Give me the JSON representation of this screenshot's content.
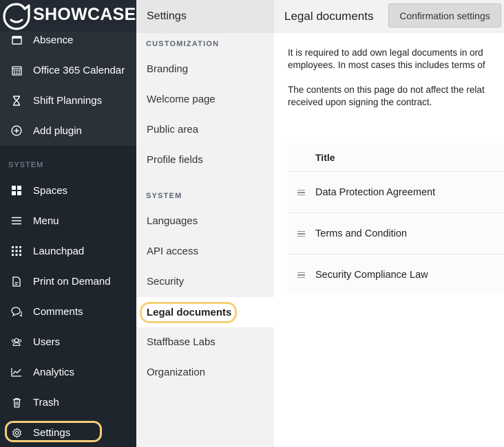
{
  "brand": {
    "name": "SHOWCASE",
    "highlight_color": "#f6cf76"
  },
  "sidebar": {
    "plugin_items": [
      {
        "label": "Absence",
        "icon": "calendar-icon"
      },
      {
        "label": "Office 365 Calendar",
        "icon": "calendar-grid-icon"
      },
      {
        "label": "Shift Plannings",
        "icon": "hourglass-icon"
      },
      {
        "label": "Add plugin",
        "icon": "plus-circle-icon"
      }
    ],
    "system_section": "SYSTEM",
    "system_items": [
      {
        "label": "Spaces",
        "icon": "grid-icon"
      },
      {
        "label": "Menu",
        "icon": "menu-icon"
      },
      {
        "label": "Launchpad",
        "icon": "apps-icon"
      },
      {
        "label": "Print on Demand",
        "icon": "document-icon"
      },
      {
        "label": "Comments",
        "icon": "comments-icon"
      },
      {
        "label": "Users",
        "icon": "users-icon"
      },
      {
        "label": "Analytics",
        "icon": "analytics-icon"
      },
      {
        "label": "Trash",
        "icon": "trash-icon"
      },
      {
        "label": "Settings",
        "icon": "gear-icon"
      }
    ]
  },
  "settings_nav": {
    "header": "Settings",
    "customization_section": "CUSTOMIZATION",
    "customization_items": [
      "Branding",
      "Welcome page",
      "Public area",
      "Profile fields"
    ],
    "system_section": "SYSTEM",
    "system_items": [
      "Languages",
      "API access",
      "Security",
      "Legal documents",
      "Staffbase Labs",
      "Organization"
    ],
    "active": "Legal documents"
  },
  "main": {
    "title": "Legal documents",
    "confirmation_button": "Confirmation settings",
    "para1_line1": "It is required to add own legal documents in ord",
    "para1_line2": "employees. In most cases this includes terms of",
    "para2_line1": "The contents on this page do not affect the relat",
    "para2_line2": "received upon signing the contract.",
    "table": {
      "column_title": "Title",
      "rows": [
        "Data Protection Agreement",
        "Terms and Condition",
        "Security Compliance Law"
      ]
    }
  }
}
